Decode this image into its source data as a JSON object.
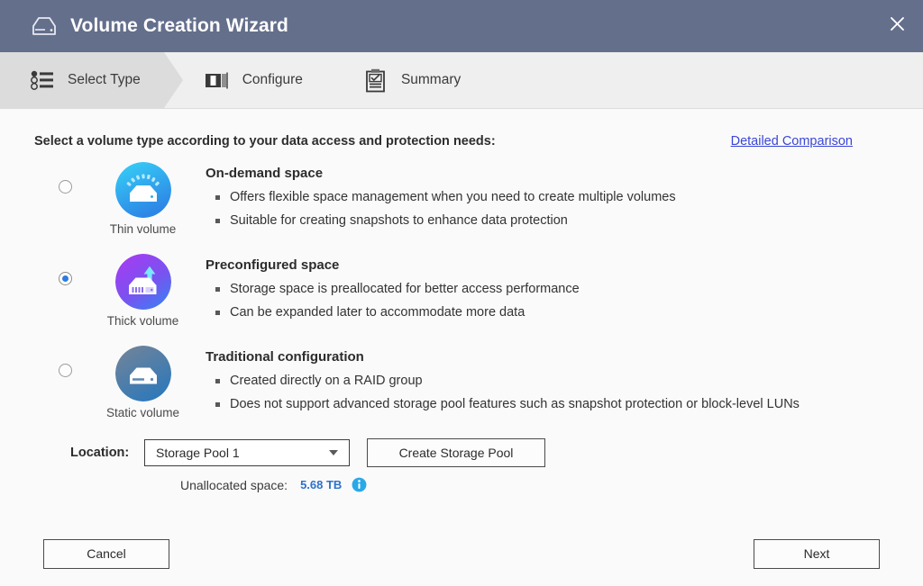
{
  "window": {
    "title": "Volume Creation Wizard",
    "title_icon": "storage-drive-icon",
    "close_label": "✕"
  },
  "steps": [
    {
      "label": "Select Type",
      "icon": "bullet-list-icon",
      "active": true
    },
    {
      "label": "Configure",
      "icon": "configure-blocks-icon",
      "active": false
    },
    {
      "label": "Summary",
      "icon": "clipboard-check-icon",
      "active": false
    }
  ],
  "main": {
    "instruction": "Select a volume type according to your data access and protection needs:",
    "comparison_link": "Detailed Comparison",
    "options": [
      {
        "id": "thin",
        "caption": "Thin volume",
        "title": "On-demand space",
        "selected": false,
        "bullets": [
          "Offers flexible space management when you need to create multiple volumes",
          "Suitable for creating snapshots to enhance data protection"
        ]
      },
      {
        "id": "thick",
        "caption": "Thick volume",
        "title": "Preconfigured space",
        "selected": true,
        "bullets": [
          "Storage space is preallocated for better access performance",
          "Can be expanded later to accommodate more data"
        ]
      },
      {
        "id": "static",
        "caption": "Static volume",
        "title": "Traditional configuration",
        "selected": false,
        "bullets": [
          "Created directly on a RAID group",
          "Does not support advanced storage pool features such as snapshot protection or block-level LUNs"
        ]
      }
    ]
  },
  "location": {
    "label": "Location:",
    "selected_pool": "Storage Pool 1",
    "create_pool_label": "Create Storage Pool",
    "unallocated_label": "Unallocated space:",
    "unallocated_value": "5.68 TB",
    "info_icon": "info-circle-icon"
  },
  "footer": {
    "cancel_label": "Cancel",
    "next_label": "Next"
  },
  "colors": {
    "titlebar": "#646f8c",
    "step_active": "#dcdcdc",
    "step_bar": "#efefef",
    "link": "#3b46d6",
    "radio_selected": "#2f7ce0",
    "unallocated_value": "#2c72c9",
    "thin_icon_gradient": [
      "#35cdf5",
      "#2f8fe8"
    ],
    "thick_icon_gradient": [
      "#9b3df0",
      "#3f7df0"
    ],
    "static_icon_gradient": [
      "#6d7f96",
      "#2f78b8"
    ]
  }
}
